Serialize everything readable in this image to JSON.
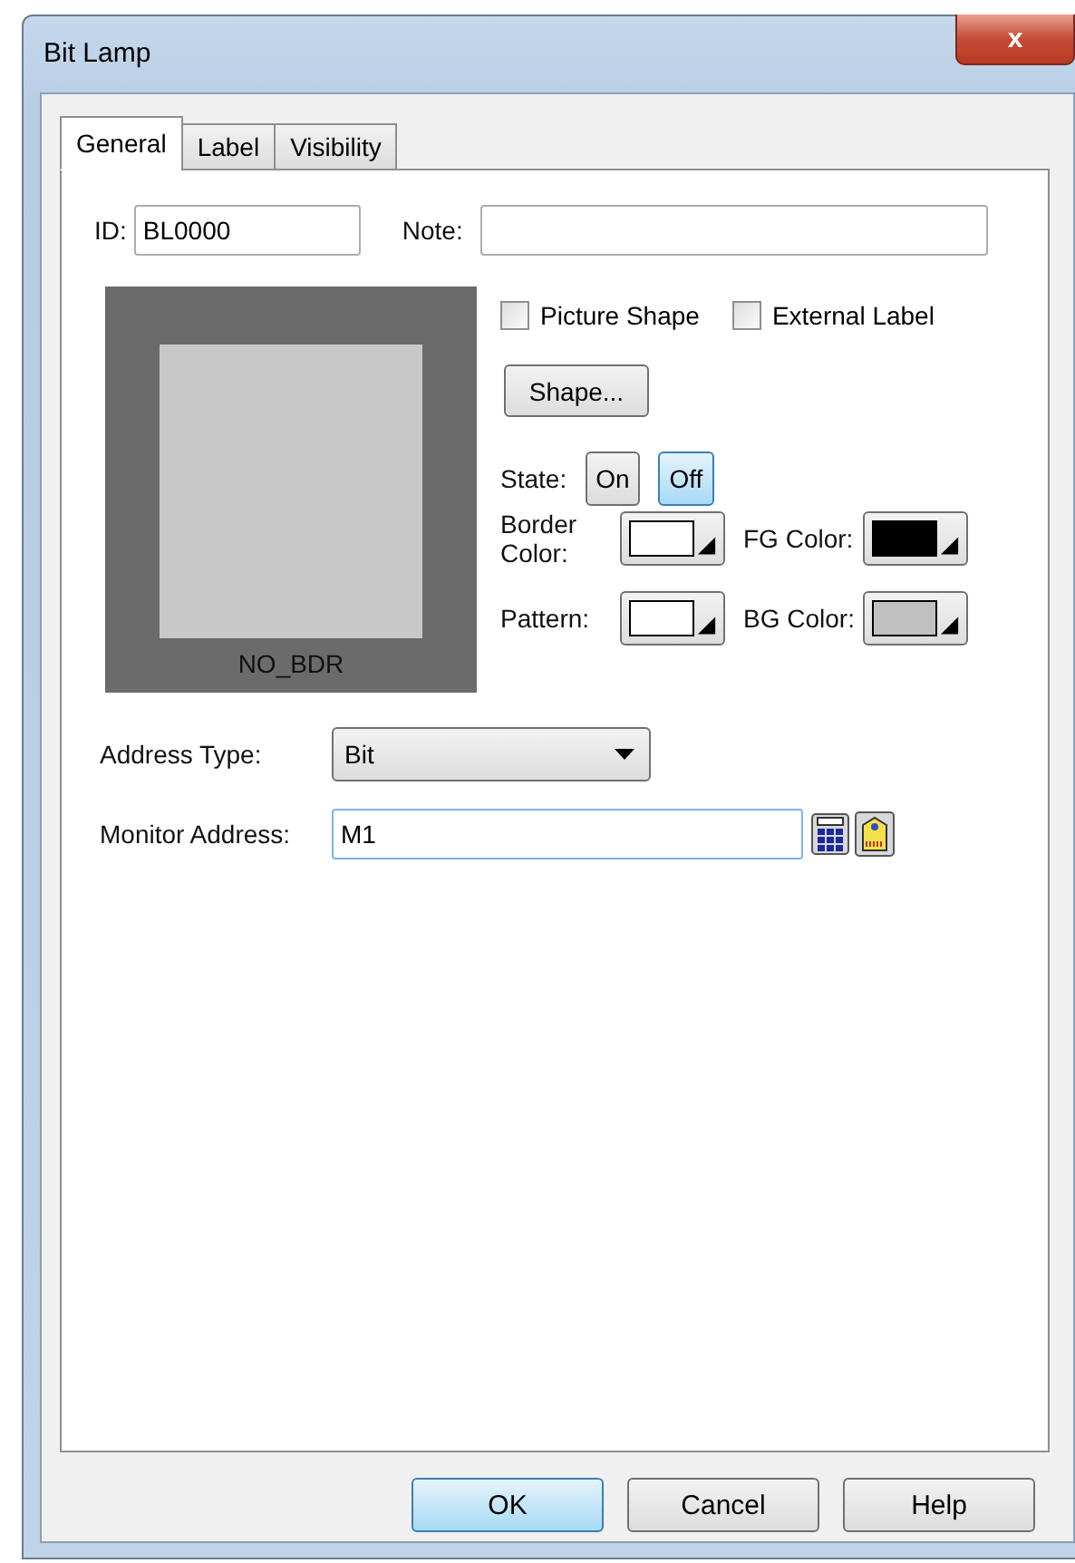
{
  "window": {
    "title": "Bit Lamp",
    "close": "x"
  },
  "tabs": [
    {
      "label": "General",
      "selected": true
    },
    {
      "label": "Label",
      "selected": false
    },
    {
      "label": "Visibility",
      "selected": false
    }
  ],
  "id": {
    "label": "ID:",
    "value": "BL0000"
  },
  "note": {
    "label": "Note:"
  },
  "preview": {
    "caption": "NO_BDR"
  },
  "checkboxes": [
    {
      "label": "Picture Shape",
      "checked": false
    },
    {
      "label": "External Label",
      "checked": false
    }
  ],
  "shape_button": "Shape...",
  "state": {
    "label": "State:",
    "options": [
      {
        "label": "On",
        "selected": false
      },
      {
        "label": "Off",
        "selected": true
      }
    ]
  },
  "color_rows": [
    [
      {
        "label": "Border Color:",
        "color": "#ffffff"
      },
      {
        "label": "FG Color:",
        "color": "#000000"
      }
    ],
    [
      {
        "label": "Pattern:",
        "color": "#ffffff"
      },
      {
        "label": "BG Color:",
        "color": "#c0c0c0"
      }
    ]
  ],
  "address_type": {
    "label": "Address Type:",
    "value": "Bit"
  },
  "monitor_address": {
    "label": "Monitor Address:",
    "value": "M1"
  },
  "buttons": [
    {
      "label": "OK",
      "default": true
    },
    {
      "label": "Cancel",
      "default": false
    },
    {
      "label": "Help",
      "default": false
    }
  ]
}
